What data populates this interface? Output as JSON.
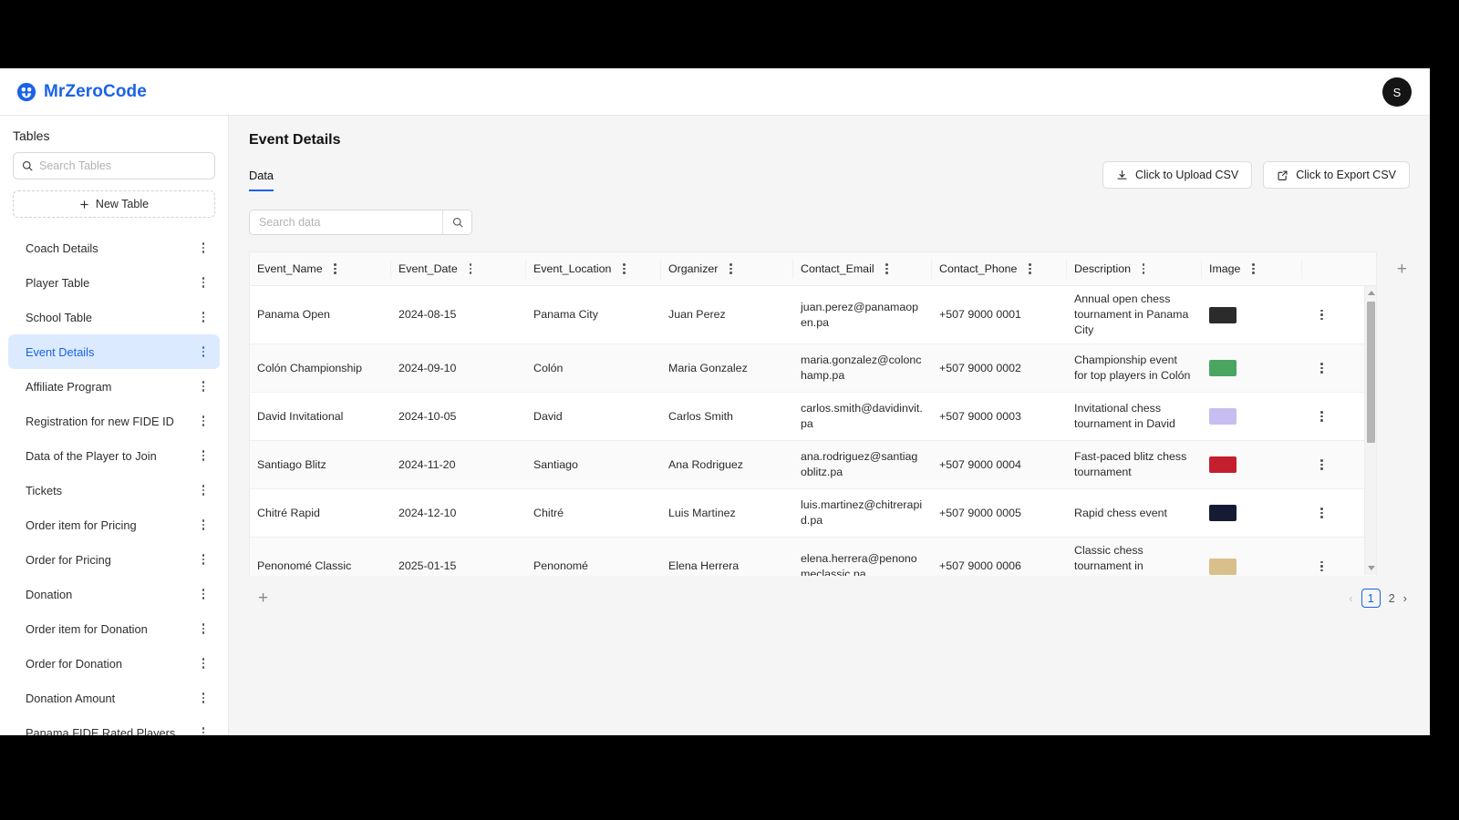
{
  "brand": {
    "name": "MrZeroCode",
    "logo_icon": "chess-pawn-logo-icon",
    "accent": "#1a63e8"
  },
  "avatar": {
    "initial": "S"
  },
  "sidebar": {
    "title": "Tables",
    "search_placeholder": "Search Tables",
    "search_value": "",
    "new_table_label": "New Table",
    "items": [
      {
        "label": "Coach Details",
        "active": false
      },
      {
        "label": "Player Table",
        "active": false
      },
      {
        "label": "School Table",
        "active": false
      },
      {
        "label": "Event Details",
        "active": true
      },
      {
        "label": "Affiliate Program",
        "active": false
      },
      {
        "label": "Registration for new FIDE ID",
        "active": false
      },
      {
        "label": "Data of the Player to Join",
        "active": false
      },
      {
        "label": "Tickets",
        "active": false
      },
      {
        "label": "Order item for Pricing",
        "active": false
      },
      {
        "label": "Order for Pricing",
        "active": false
      },
      {
        "label": "Donation",
        "active": false
      },
      {
        "label": "Order item for Donation",
        "active": false
      },
      {
        "label": "Order for Donation",
        "active": false
      },
      {
        "label": "Donation Amount",
        "active": false
      },
      {
        "label": "Panama FIDE Rated Players",
        "active": false
      }
    ]
  },
  "main": {
    "page_title": "Event Details",
    "tab_label": "Data",
    "upload_csv_label": "Click to Upload CSV",
    "export_csv_label": "Click to Export CSV",
    "search_placeholder": "Search data",
    "search_value": "",
    "add_column_label": "+",
    "add_row_label": "+"
  },
  "table": {
    "columns": [
      "Event_Name",
      "Event_Date",
      "Event_Location",
      "Organizer",
      "Contact_Email",
      "Contact_Phone",
      "Description",
      "Image"
    ],
    "rows": [
      {
        "Event_Name": "Panama Open",
        "Event_Date": "2024-08-15",
        "Event_Location": "Panama City",
        "Organizer": "Juan Perez",
        "Contact_Email": "juan.perez@panamaopen.pa",
        "Contact_Phone": "+507 9000 0001",
        "Description": "Annual open chess tournament in Panama City",
        "Image": "event-thumbnail",
        "thumb_color": "#2b2b2b"
      },
      {
        "Event_Name": "Colón Championship",
        "Event_Date": "2024-09-10",
        "Event_Location": "Colón",
        "Organizer": "Maria Gonzalez",
        "Contact_Email": "maria.gonzalez@colonchamp.pa",
        "Contact_Phone": "+507 9000 0002",
        "Description": "Championship event for top players in Colón",
        "Image": "event-thumbnail",
        "thumb_color": "#4aa560"
      },
      {
        "Event_Name": "David Invitational",
        "Event_Date": "2024-10-05",
        "Event_Location": "David",
        "Organizer": "Carlos Smith",
        "Contact_Email": "carlos.smith@davidinvit.pa",
        "Contact_Phone": "+507 9000 0003",
        "Description": "Invitational chess tournament in David",
        "Image": "event-thumbnail",
        "thumb_color": "#c8bdf0"
      },
      {
        "Event_Name": "Santiago Blitz",
        "Event_Date": "2024-11-20",
        "Event_Location": "Santiago",
        "Organizer": "Ana Rodriguez",
        "Contact_Email": "ana.rodriguez@santiagoblitz.pa",
        "Contact_Phone": "+507 9000 0004",
        "Description": "Fast-paced blitz chess tournament",
        "Image": "event-thumbnail",
        "thumb_color": "#c41f2e"
      },
      {
        "Event_Name": "Chitré Rapid",
        "Event_Date": "2024-12-10",
        "Event_Location": "Chitré",
        "Organizer": "Luis Martinez",
        "Contact_Email": "luis.martinez@chitrerapid.pa",
        "Contact_Phone": "+507 9000 0005",
        "Description": "Rapid chess event",
        "Image": "event-thumbnail",
        "thumb_color": "#161b33"
      },
      {
        "Event_Name": "Penonomé Classic",
        "Event_Date": "2025-01-15",
        "Event_Location": "Penonomé",
        "Organizer": "Elena Herrera",
        "Contact_Email": "elena.herrera@penonomeclassic.pa",
        "Contact_Phone": "+507 9000 0006",
        "Description": "Classic chess tournament in Penonomé",
        "Image": "event-thumbnail",
        "thumb_color": "#d9c08a"
      }
    ]
  },
  "pagination": {
    "prev": "‹",
    "next": "›",
    "pages": [
      "1",
      "2"
    ],
    "current": "1"
  }
}
